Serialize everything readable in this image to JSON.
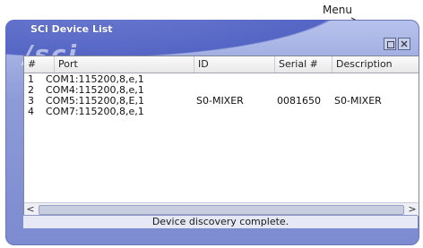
{
  "callout": {
    "label": "Menu"
  },
  "window": {
    "title": "SCi Device List",
    "logo": "/sci"
  },
  "table": {
    "columns": [
      "#",
      "Port",
      "ID",
      "Serial #",
      "Description"
    ],
    "rows": [
      {
        "num": "1",
        "port": "COM1:115200,8,e,1",
        "id": "",
        "serial": "",
        "description": ""
      },
      {
        "num": "2",
        "port": "COM4:115200,8,e,1",
        "id": "",
        "serial": "",
        "description": ""
      },
      {
        "num": "3",
        "port": "COM5:115200,8,E,1",
        "id": "S0-MIXER",
        "serial": "0081650",
        "description": "S0-MIXER"
      },
      {
        "num": "4",
        "port": "COM7:115200,8,e,1",
        "id": "",
        "serial": "",
        "description": ""
      }
    ]
  },
  "scrollbar": {
    "left_arrow": "<",
    "right_arrow": ">"
  },
  "status": {
    "text": "Device discovery complete."
  },
  "icons": {
    "restore_button": "restore-icon",
    "close_button": "close-icon"
  }
}
